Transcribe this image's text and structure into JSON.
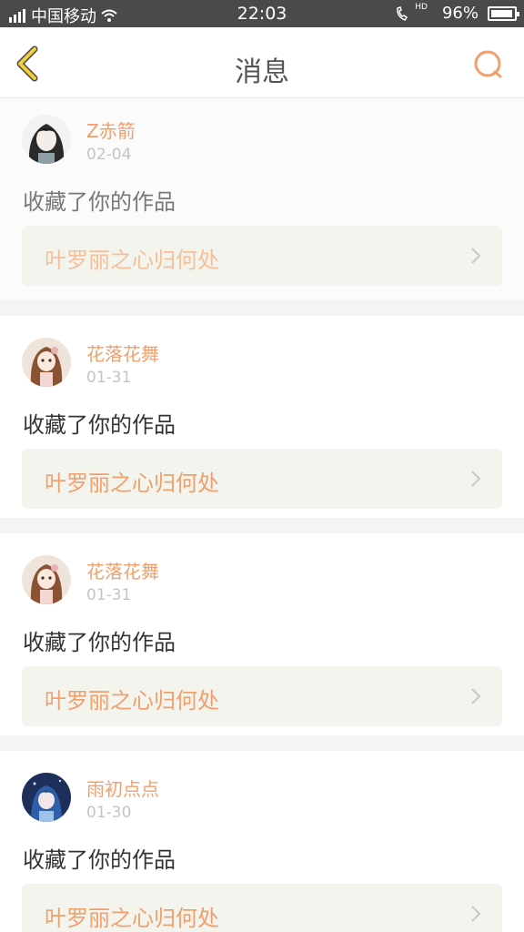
{
  "status_bar": {
    "carrier": "中国移动",
    "time": "22:03",
    "battery": "96%",
    "battery_level": 0.96,
    "hd_label": "HD"
  },
  "nav": {
    "title": "消息",
    "back_icon": "chevron-left-icon",
    "search_icon": "search-icon",
    "accent_color": "#f0a06c",
    "back_color": "#f2cf3a"
  },
  "messages": [
    {
      "username": "Z赤箭",
      "date": "02-04",
      "action": "收藏了你的作品",
      "work_title": "叶罗丽之心归何处",
      "avatar": "avatar-dark-hair"
    },
    {
      "username": "花落花舞",
      "date": "01-31",
      "action": "收藏了你的作品",
      "work_title": "叶罗丽之心归何处",
      "avatar": "avatar-doll"
    },
    {
      "username": "花落花舞",
      "date": "01-31",
      "action": "收藏了你的作品",
      "work_title": "叶罗丽之心归何处",
      "avatar": "avatar-doll"
    },
    {
      "username": "雨初点点",
      "date": "01-30",
      "action": "收藏了你的作品",
      "work_title": "叶罗丽之心归何处",
      "avatar": "avatar-blue"
    }
  ]
}
